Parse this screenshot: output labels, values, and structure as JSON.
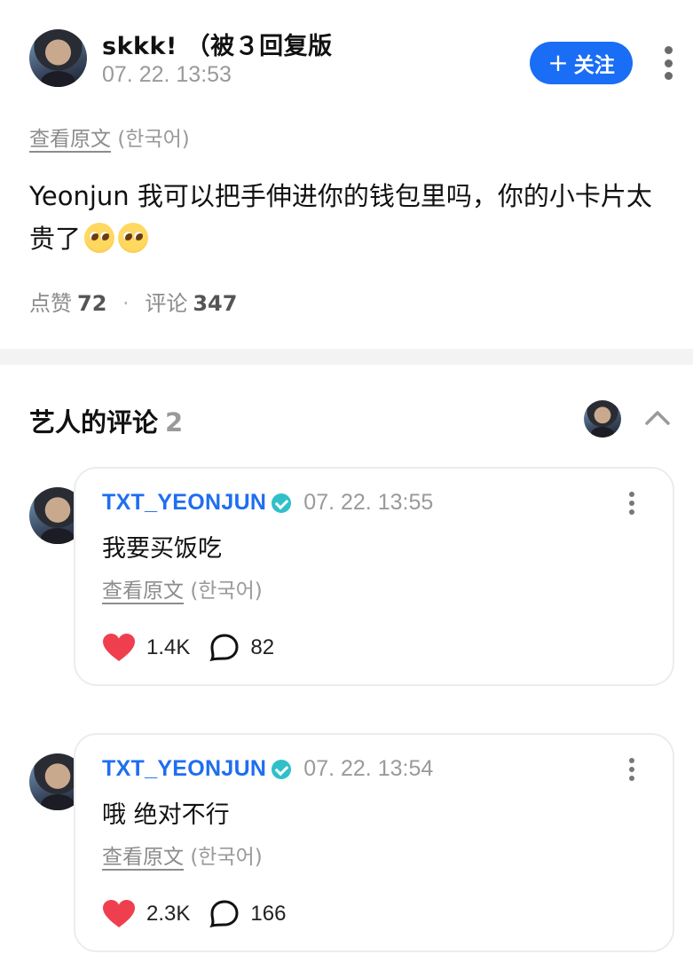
{
  "post": {
    "author": "skkk! （被３回复版",
    "time": "07. 22. 13:53",
    "follow_label": "关注",
    "view_original": "查看原文",
    "language": "(한국어)",
    "body_text": "Yeonjun 我可以把手伸进你的钱包里吗，你的小卡片太贵了",
    "emoji_name": "pleading-face",
    "likes_label": "点赞",
    "likes_count": "72",
    "comments_label": "评论",
    "comments_count": "347"
  },
  "artist_comments": {
    "title": "艺人的评论",
    "count": "2",
    "items": [
      {
        "name": "TXT_YEONJUN",
        "time": "07. 22. 13:55",
        "text": "我要买饭吃",
        "view_original": "查看原文",
        "language": "(한국어)",
        "likes": "1.4K",
        "replies": "82"
      },
      {
        "name": "TXT_YEONJUN",
        "time": "07. 22. 13:54",
        "text": "哦 绝对不行",
        "view_original": "查看原文",
        "language": "(한국어)",
        "likes": "2.3K",
        "replies": "166"
      }
    ]
  },
  "icons": {
    "follow": "plus-icon",
    "more": "more-vertical-icon",
    "verified": "verified-badge-icon",
    "collapse": "chevron-up-icon",
    "like": "heart-icon",
    "reply": "speech-bubble-icon"
  },
  "colors": {
    "accent": "#1a6df5",
    "artist_name": "#1f6ef0",
    "verified": "#2fc0c9",
    "heart": "#ef3f4f",
    "muted_text": "#9a9a9a"
  }
}
